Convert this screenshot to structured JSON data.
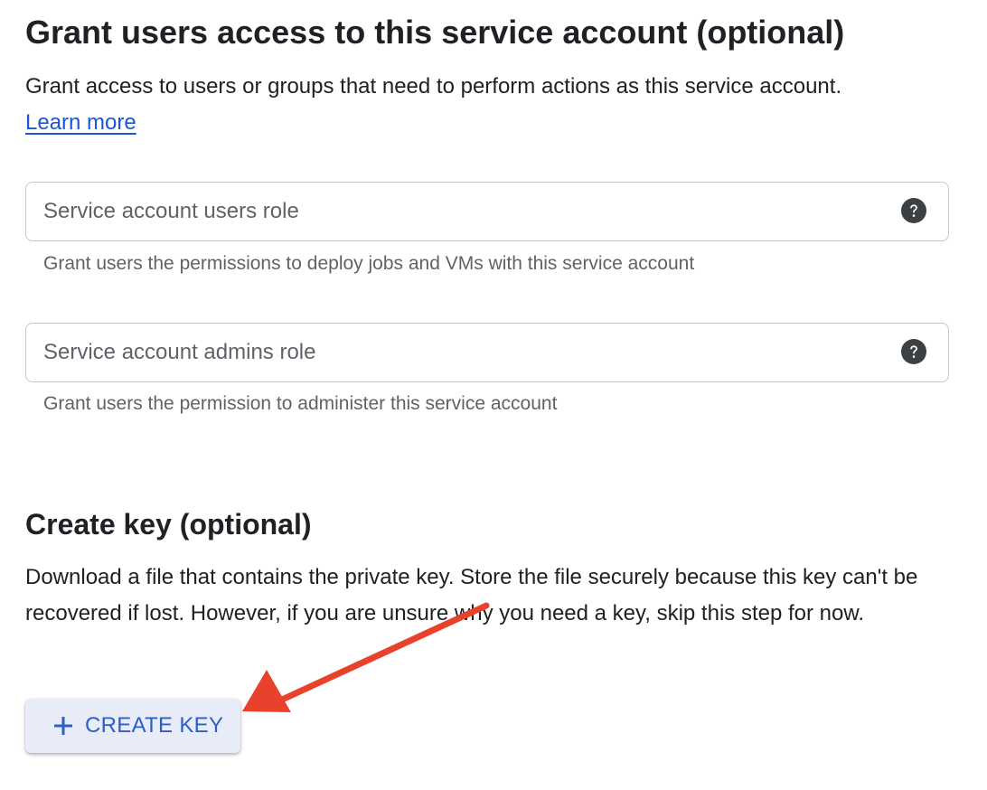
{
  "section_users": {
    "title": "Grant users access to this service account (optional)",
    "description": "Grant access to users or groups that need to perform actions as this service account.",
    "learn_more": "Learn more",
    "fields": [
      {
        "label": "Service account users role",
        "hint": "Grant users the permissions to deploy jobs and VMs with this service account",
        "help_icon": "help-circle-icon"
      },
      {
        "label": "Service account admins role",
        "hint": "Grant users the permission to administer this service account",
        "help_icon": "help-circle-icon"
      }
    ]
  },
  "section_key": {
    "title": "Create key (optional)",
    "description": "Download a file that contains the private key. Store the file securely because this key can't be recovered if lost. However, if you are unsure why you need a key, skip this step for now.",
    "button_label": "CREATE KEY",
    "button_icon": "plus-icon"
  },
  "colors": {
    "link": "#1a56d6",
    "button_text": "#2d5fc4",
    "button_bg": "#e8ecf8",
    "annotation_arrow": "#e8412c"
  }
}
